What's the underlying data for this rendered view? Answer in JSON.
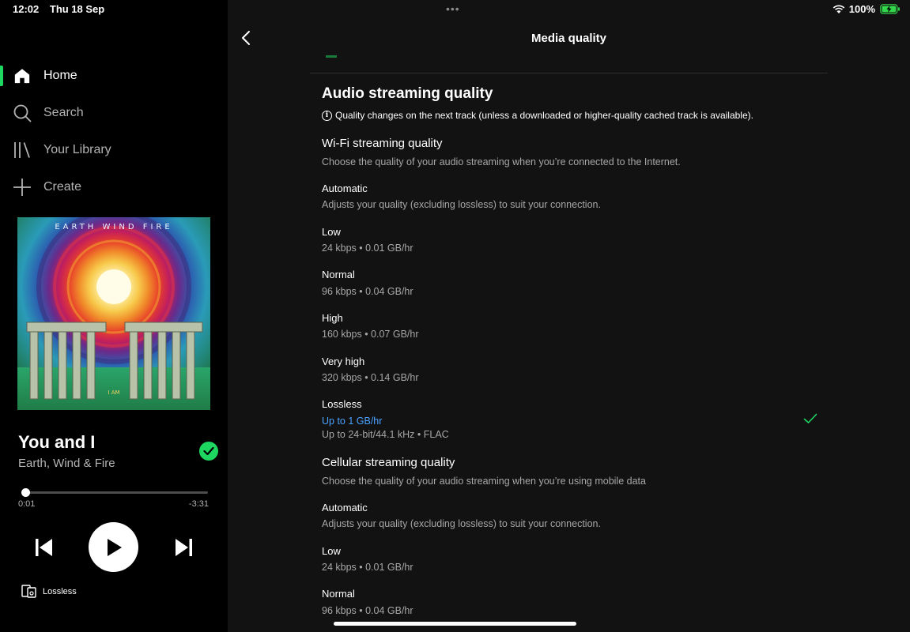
{
  "status_bar": {
    "time": "12:02",
    "date": "Thu 18 Sep",
    "battery": "100%",
    "icons": [
      "wifi-icon",
      "battery-charging-icon"
    ],
    "battery_color": "#32d74b"
  },
  "sidebar": {
    "items": [
      {
        "label": "Home",
        "icon": "home-icon",
        "active": true
      },
      {
        "label": "Search",
        "icon": "search-icon",
        "active": false
      },
      {
        "label": "Your Library",
        "icon": "library-icon",
        "active": false
      },
      {
        "label": "Create",
        "icon": "plus-icon",
        "active": false
      }
    ]
  },
  "now_playing": {
    "album_art_text": "EARTH WIND FIRE",
    "album_art_caption": "I AM",
    "title": "You and I",
    "artist": "Earth, Wind & Fire",
    "saved": true,
    "progress_fraction": 0.02,
    "elapsed": "0:01",
    "remaining": "-3:31",
    "device_label": "Lossless",
    "accent_color": "#1ed760"
  },
  "page": {
    "title": "Media quality"
  },
  "audio": {
    "section_title": "Audio streaming quality",
    "info_text": "Quality changes on the next track (unless a downloaded or higher-quality cached track is available).",
    "wifi": {
      "title": "Wi-Fi streaming quality",
      "desc": "Choose the quality of your audio streaming when you’re connected to the Internet.",
      "options": [
        {
          "label": "Automatic",
          "detail": "Adjusts your quality (excluding lossless) to suit your connection."
        },
        {
          "label": "Low",
          "detail": "24 kbps • 0.01 GB/hr"
        },
        {
          "label": "Normal",
          "detail": "96 kbps • 0.04 GB/hr"
        },
        {
          "label": "High",
          "detail": "160 kbps • 0.07 GB/hr"
        },
        {
          "label": "Very high",
          "detail": "320 kbps • 0.14 GB/hr"
        },
        {
          "label": "Lossless",
          "link": "Up to 1 GB/hr",
          "detail": "Up to 24-bit/44.1 kHz • FLAC",
          "selected": true
        }
      ]
    },
    "cellular": {
      "title": "Cellular streaming quality",
      "desc": "Choose the quality of your audio streaming when you’re using mobile data",
      "options": [
        {
          "label": "Automatic",
          "detail": "Adjusts your quality (excluding lossless) to suit your connection."
        },
        {
          "label": "Low",
          "detail": "24 kbps • 0.01 GB/hr"
        },
        {
          "label": "Normal",
          "detail": "96 kbps • 0.04 GB/hr"
        }
      ]
    }
  }
}
